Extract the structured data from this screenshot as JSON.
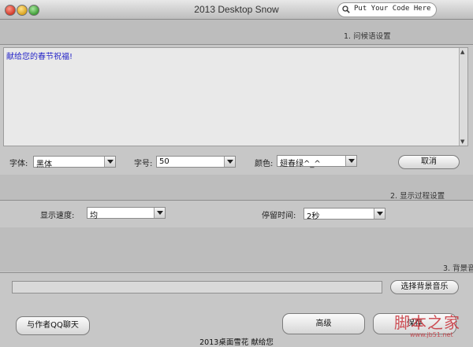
{
  "window": {
    "title": "2013 Desktop Snow",
    "search_text": "Put Your Code Here"
  },
  "section1": {
    "label": "1. 问候语设置",
    "message_text": "献给您的春节祝福!"
  },
  "font_row": {
    "font_label": "字体:",
    "font_value": "黑体",
    "size_label": "字号:",
    "size_value": "50",
    "color_label": "颜色:",
    "color_value": "翅春绿^_^",
    "cancel_label": "取消"
  },
  "section2": {
    "label": "2. 显示过程设置",
    "speed_label": "显示速度:",
    "speed_value": "均",
    "stay_label": "停留时间:",
    "stay_value": "2秒"
  },
  "section3": {
    "label": "3. 背景音",
    "choose_music_label": "选择背景音乐"
  },
  "bottom": {
    "chat_label": "与作者QQ聊天",
    "advanced_label": "高级",
    "save_label": "保存",
    "footer_text": "2013桌面雪花  献给您"
  },
  "watermark": {
    "text": "脚本之家",
    "url": "www.jb51.net"
  },
  "colors": {
    "message_text": "#2626c8",
    "watermark": "#c8323a"
  }
}
